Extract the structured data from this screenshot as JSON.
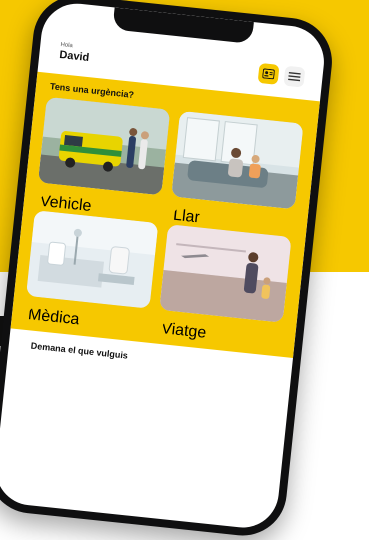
{
  "header": {
    "greeting_small": "Hola",
    "user_name": "David"
  },
  "urgency": {
    "title": "Tens una urgència?",
    "cards": [
      {
        "label": "Vehicle"
      },
      {
        "label": "Llar"
      },
      {
        "label": "Mèdica"
      },
      {
        "label": "Viatge"
      }
    ]
  },
  "bottom": {
    "title": "Demana el que vulguis"
  },
  "colors": {
    "brand_yellow": "#f6c800",
    "phone_body": "#0f0f10"
  }
}
